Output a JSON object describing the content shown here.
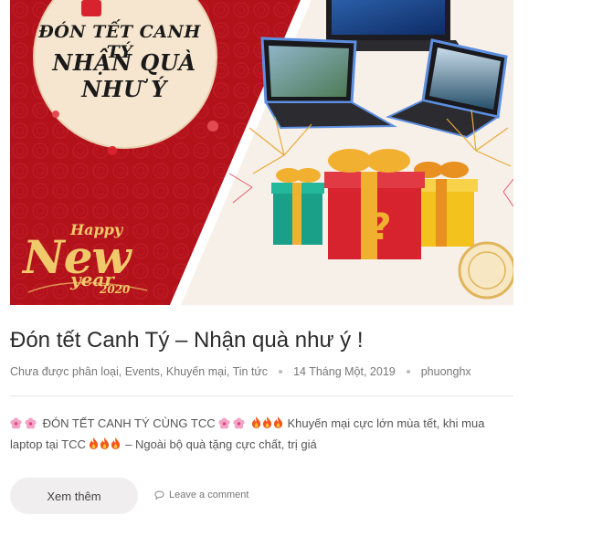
{
  "hero": {
    "promo_line1": "ĐÓN TẾT CANH TÝ",
    "promo_line2": "NHẬN QUÀ NHƯ Ý",
    "greeting_happy": "Happy",
    "greeting_new": "New",
    "greeting_year": "year",
    "greeting_number": "2020"
  },
  "post": {
    "title": "Đón tết Canh Tý – Nhận quà như ý !",
    "categories": "Chưa được phân loại, Events, Khuyến mại, Tin tức",
    "date": "14 Tháng Một, 2019",
    "author": "phuonghx",
    "excerpt_part1": "ĐÓN TẾT CANH TÝ CÙNG TCC",
    "excerpt_part2": "Khuyến mại cực lớn mùa tết, khi mua laptop tại TCC",
    "excerpt_part3": "– Ngoài bộ quà tặng cực chất, trị giá",
    "read_more_label": "Xem thêm",
    "comment_label": "Leave a comment"
  },
  "colors": {
    "brand_red": "#b3121b",
    "gold": "#f0c96a",
    "title_text": "#2b2b2b",
    "meta_text": "#777777"
  }
}
